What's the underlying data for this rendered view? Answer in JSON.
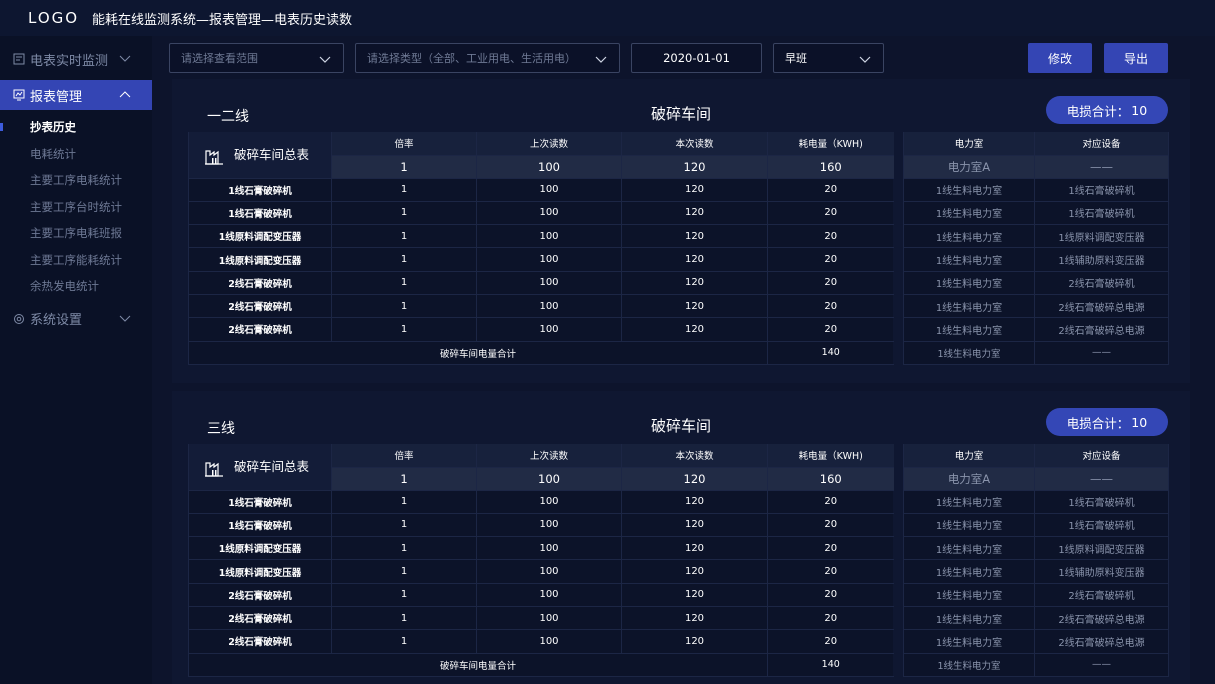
{
  "logo": "LOGO",
  "app_title": "能耗在线监测系统—报表管理—电表历史读数",
  "sidebar": {
    "groups": [
      {
        "label": "电表实时监测",
        "icon": "meter-icon"
      },
      {
        "label": "报表管理",
        "icon": "chart-icon"
      },
      {
        "label": "系统设置",
        "icon": "gear-icon"
      }
    ],
    "sub_items": [
      "抄表历史",
      "电耗统计",
      "主要工序电耗统计",
      "主要工序台时统计",
      "主要工序电耗班报",
      "主要工序能耗统计",
      "余热发电统计"
    ]
  },
  "filters": {
    "scope_placeholder": "请选择查看范围",
    "type_placeholder": "请选择类型（全部、工业用电、生活用电）",
    "date": "2020-01-01",
    "shift": "早班"
  },
  "buttons": {
    "edit": "修改",
    "export": "导出"
  },
  "sections": [
    {
      "line": "一二线",
      "workshop": "破碎车间",
      "loss_label": "电损合计：",
      "loss_value": "10",
      "headers": [
        "倍率",
        "上次读数",
        "本次读数",
        "耗电量（KWH)"
      ],
      "right_headers": [
        "电力室",
        "对应设备"
      ],
      "total_label": "破碎车间总表",
      "total_values": [
        "1",
        "100",
        "120",
        "160"
      ],
      "total_right": [
        "电力室A",
        "——"
      ],
      "rows": [
        {
          "name": "1线石膏破碎机",
          "values": [
            "1",
            "100",
            "120",
            "20"
          ],
          "room": "1线生料电力室",
          "device": "1线石膏破碎机"
        },
        {
          "name": "1线石膏破碎机",
          "values": [
            "1",
            "100",
            "120",
            "20"
          ],
          "room": "1线生料电力室",
          "device": "1线石膏破碎机"
        },
        {
          "name": "1线原料调配变压器",
          "values": [
            "1",
            "100",
            "120",
            "20"
          ],
          "room": "1线生料电力室",
          "device": "1线原料调配变压器"
        },
        {
          "name": "1线原料调配变压器",
          "values": [
            "1",
            "100",
            "120",
            "20"
          ],
          "room": "1线生料电力室",
          "device": "1线辅助原料变压器"
        },
        {
          "name": "2线石膏破碎机",
          "values": [
            "1",
            "100",
            "120",
            "20"
          ],
          "room": "1线生料电力室",
          "device": "2线石膏破碎机"
        },
        {
          "name": "2线石膏破碎机",
          "values": [
            "1",
            "100",
            "120",
            "20"
          ],
          "room": "1线生料电力室",
          "device": "2线石膏破碎总电源"
        },
        {
          "name": "2线石膏破碎机",
          "values": [
            "1",
            "100",
            "120",
            "20"
          ],
          "room": "1线生料电力室",
          "device": "2线石膏破碎总电源"
        }
      ],
      "sum_label": "破碎车间电量合计",
      "sum_value": "140",
      "sum_room": "1线生料电力室",
      "sum_device": "——"
    },
    {
      "line": "三线",
      "workshop": "破碎车间",
      "loss_label": "电损合计：",
      "loss_value": "10",
      "headers": [
        "倍率",
        "上次读数",
        "本次读数",
        "耗电量（KWH)"
      ],
      "right_headers": [
        "电力室",
        "对应设备"
      ],
      "total_label": "破碎车间总表",
      "total_values": [
        "1",
        "100",
        "120",
        "160"
      ],
      "total_right": [
        "电力室A",
        "——"
      ],
      "rows": [
        {
          "name": "1线石膏破碎机",
          "values": [
            "1",
            "100",
            "120",
            "20"
          ],
          "room": "1线生料电力室",
          "device": "1线石膏破碎机"
        },
        {
          "name": "1线石膏破碎机",
          "values": [
            "1",
            "100",
            "120",
            "20"
          ],
          "room": "1线生料电力室",
          "device": "1线石膏破碎机"
        },
        {
          "name": "1线原料调配变压器",
          "values": [
            "1",
            "100",
            "120",
            "20"
          ],
          "room": "1线生料电力室",
          "device": "1线原料调配变压器"
        },
        {
          "name": "1线原料调配变压器",
          "values": [
            "1",
            "100",
            "120",
            "20"
          ],
          "room": "1线生料电力室",
          "device": "1线辅助原料变压器"
        },
        {
          "name": "2线石膏破碎机",
          "values": [
            "1",
            "100",
            "120",
            "20"
          ],
          "room": "1线生料电力室",
          "device": "2线石膏破碎机"
        },
        {
          "name": "2线石膏破碎机",
          "values": [
            "1",
            "100",
            "120",
            "20"
          ],
          "room": "1线生料电力室",
          "device": "2线石膏破碎总电源"
        },
        {
          "name": "2线石膏破碎机",
          "values": [
            "1",
            "100",
            "120",
            "20"
          ],
          "room": "1线生料电力室",
          "device": "2线石膏破碎总电源"
        }
      ],
      "sum_label": "破碎车间电量合计",
      "sum_value": "140",
      "sum_room": "1线生料电力室",
      "sum_device": "——"
    }
  ]
}
